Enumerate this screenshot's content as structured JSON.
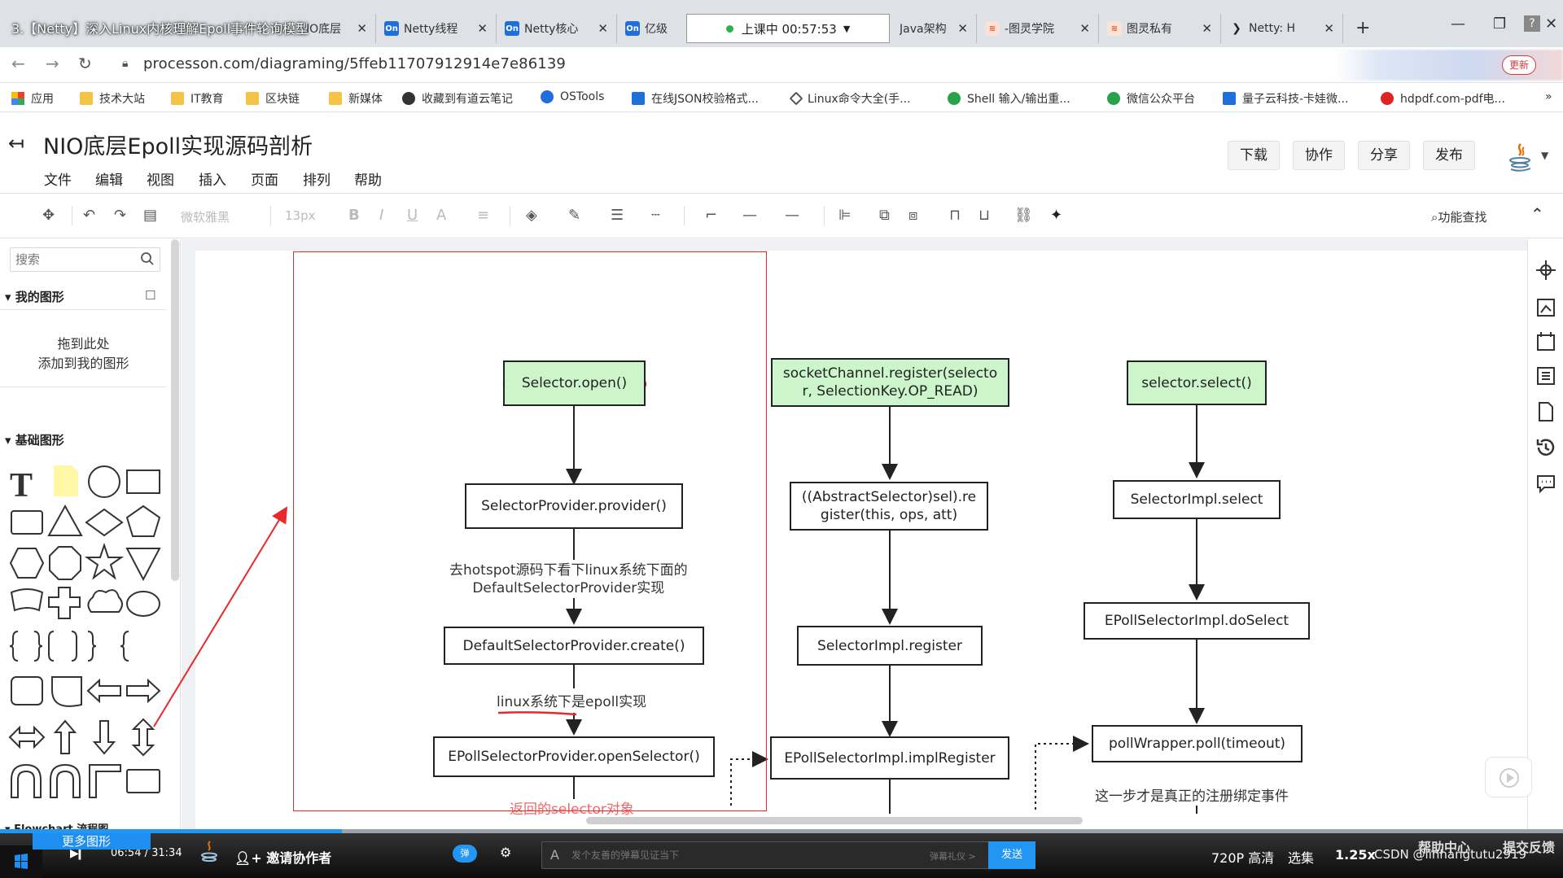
{
  "video": {
    "title": "3.【Netty】深入Linux内核理解Epoll事件轮询模型",
    "live_status": "上课中 00:57:53",
    "current_time": "06:54",
    "total_time": "31:34",
    "progress": 0.219,
    "invite_label": "邀请协作者",
    "danmaku_placeholder": "发个友善的弹幕见证当下",
    "danmaku_etiquette": "弹幕礼仪 >",
    "send_label": "发送",
    "quality": "720P 高清",
    "episodes": "选集",
    "speed": "1.25x",
    "watermark": "CSDN @linhangtutu2919",
    "help_center": "帮助中心",
    "feedback": "提交反馈"
  },
  "browser": {
    "tabs": [
      {
        "label": "IO底层",
        "icon": "none"
      },
      {
        "label": "Netty线程",
        "icon": "On"
      },
      {
        "label": "Netty核心",
        "icon": "On"
      },
      {
        "label": "亿级",
        "icon": "On"
      },
      {
        "label": "Java架构",
        "icon": "none"
      },
      {
        "label": "-图灵学院",
        "icon": "tl"
      },
      {
        "label": "图灵私有",
        "icon": "tl"
      },
      {
        "label": "Netty: H",
        "icon": "nt"
      }
    ],
    "url": "processon.com/diagraming/5ffeb11707912914e7e86139",
    "update_label": "更新",
    "bookmarks": [
      "应用",
      "技术大站",
      "IT教育",
      "区块链",
      "新媒体",
      "收藏到有道云笔记",
      "OSTools",
      "在线JSON校验格式...",
      "Linux命令大全(手...",
      "Shell 输入/输出重...",
      "微信公众平台",
      "量子云科技-卡娃微...",
      "hdpdf.com-pdf电..."
    ],
    "bookmarks_more": "»"
  },
  "app": {
    "doc_title": "NIO底层Epoll实现源码剖析",
    "menus": [
      "文件",
      "编辑",
      "视图",
      "插入",
      "页面",
      "排列",
      "帮助"
    ],
    "header_buttons": [
      "下载",
      "协作",
      "分享",
      "发布"
    ],
    "font_name": "微软雅黑",
    "font_size": "13px",
    "func_search": "功能查找"
  },
  "sidebar": {
    "search_placeholder": "搜索",
    "my_shapes": "我的图形",
    "drop_hint_line1": "拖到此处",
    "drop_hint_line2": "添加到我的图形",
    "basic_shapes": "基础图形",
    "flowchart": "Flowchart 流程图",
    "more_shapes": "更多图形"
  },
  "diagram": {
    "col1": {
      "n1": "Selector.open()",
      "n2": "SelectorProvider.provider()",
      "note1_l1": "去hotspot源码下看下linux系统下面的",
      "note1_l2": "DefaultSelectorProvider实现",
      "n3": "DefaultSelectorProvider.create()",
      "note2": "linux系统下是epoll实现",
      "n4": "EPollSelectorProvider.openSelector()",
      "note3": "返回的selector对象"
    },
    "col2": {
      "n1_l1": "socketChannel.register(selecto",
      "n1_l2": "r, SelectionKey.OP_READ)",
      "n2_l1": "((AbstractSelector)sel).re",
      "n2_l2": "gister(this, ops, att)",
      "n3": "SelectorImpl.register",
      "n4": "EPollSelectorImpl.implRegister"
    },
    "col3": {
      "n1": "selector.select()",
      "n2": "SelectorImpl.select",
      "n3": "EPollSelectorImpl.doSelect",
      "n4": "pollWrapper.poll(timeout)",
      "note1": "这一步才是真正的注册绑定事件"
    }
  },
  "colors": {
    "green_node": "#ccf5cc",
    "red_annotation": "#e8282b",
    "accent_blue": "#2396f3"
  }
}
